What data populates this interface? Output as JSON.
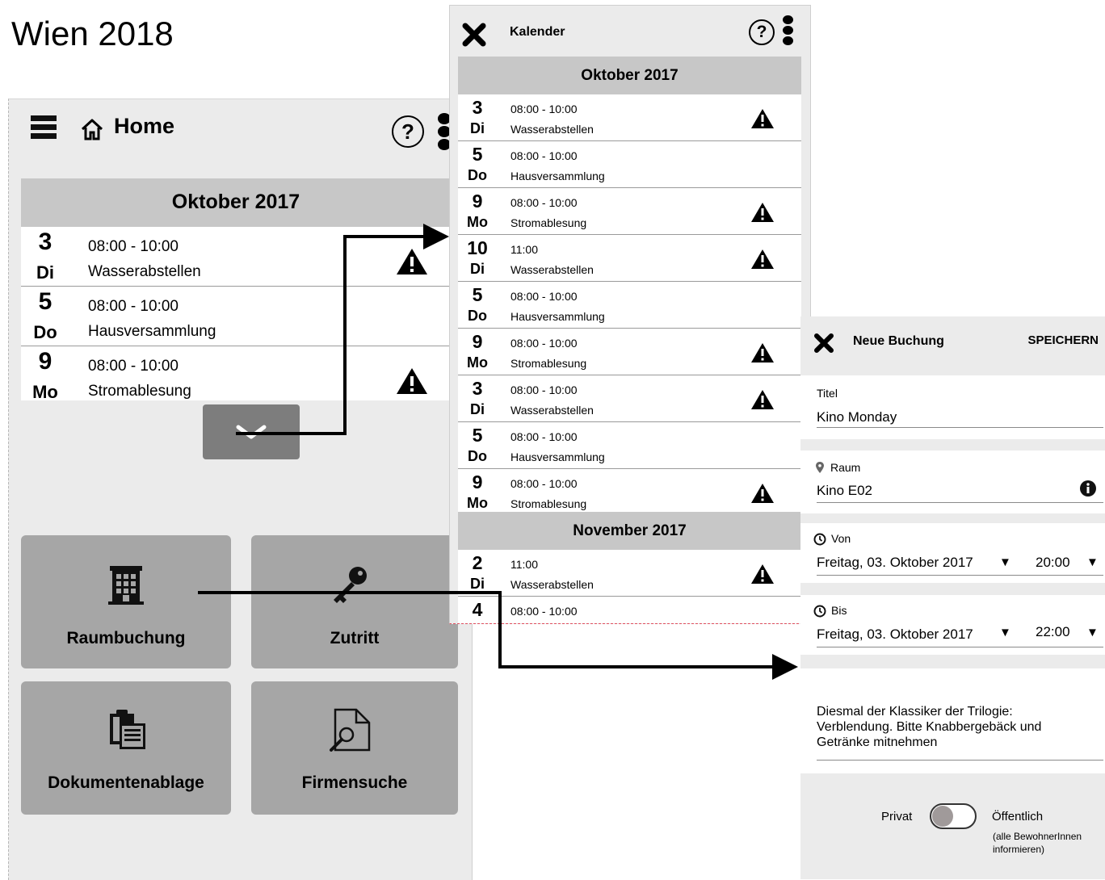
{
  "slide_title": "Wien 2018",
  "home": {
    "title": "Home",
    "help_label": "?",
    "month": "Oktober 2017",
    "events": [
      {
        "day": "3",
        "dow": "Di",
        "time": "08:00 - 10:00",
        "name": "Wasserabstellen",
        "warning": true
      },
      {
        "day": "5",
        "dow": "Do",
        "time": "08:00 - 10:00",
        "name": "Hausversammlung",
        "warning": false
      },
      {
        "day": "9",
        "dow": "Mo",
        "time": "08:00 - 10:00",
        "name": "Stromablesung",
        "warning": true
      }
    ],
    "tiles": [
      "Raumbuchung",
      "Zutritt",
      "Dokumentenablage",
      "Firmensuche"
    ]
  },
  "calendar": {
    "title": "Kalender",
    "help_label": "?",
    "months": [
      {
        "name": "Oktober 2017",
        "events": [
          {
            "day": "3",
            "dow": "Di",
            "time": "08:00 - 10:00",
            "name": "Wasserabstellen",
            "warning": true
          },
          {
            "day": "5",
            "dow": "Do",
            "time": "08:00 - 10:00",
            "name": "Hausversammlung",
            "warning": false
          },
          {
            "day": "9",
            "dow": "Mo",
            "time": "08:00 - 10:00",
            "name": "Stromablesung",
            "warning": true
          },
          {
            "day": "10",
            "dow": "Di",
            "time": "11:00",
            "name": "Wasserabstellen",
            "warning": true
          },
          {
            "day": "5",
            "dow": "Do",
            "time": "08:00 - 10:00",
            "name": "Hausversammlung",
            "warning": false
          },
          {
            "day": "9",
            "dow": "Mo",
            "time": "08:00 - 10:00",
            "name": "Stromablesung",
            "warning": true
          },
          {
            "day": "3",
            "dow": "Di",
            "time": "08:00 - 10:00",
            "name": "Wasserabstellen",
            "warning": true
          },
          {
            "day": "5",
            "dow": "Do",
            "time": "08:00 - 10:00",
            "name": "Hausversammlung",
            "warning": false
          },
          {
            "day": "9",
            "dow": "Mo",
            "time": "08:00 - 10:00",
            "name": "Stromablesung",
            "warning": true
          }
        ]
      },
      {
        "name": "November 2017",
        "events": [
          {
            "day": "2",
            "dow": "Di",
            "time": "11:00",
            "name": "Wasserabstellen",
            "warning": true
          },
          {
            "day": "4",
            "dow": "",
            "time": "08:00 - 10:00",
            "name": "",
            "warning": false
          }
        ]
      }
    ]
  },
  "booking": {
    "title": "Neue Buchung",
    "save_label": "SPEICHERN",
    "title_label": "Titel",
    "title_value": "Kino Monday",
    "room_label": "Raum",
    "room_value": "Kino E02",
    "from_label": "Von",
    "from_date": "Freitag, 03. Oktober 2017",
    "from_time": "20:00",
    "to_label": "Bis",
    "to_date": "Freitag, 03. Oktober 2017",
    "to_time": "22:00",
    "description": "Diesmal der Klassiker der Trilogie: Verblendung. Bitte Knabbergebäck und Getränke mitnehmen",
    "private_label": "Privat",
    "public_label": "Öffentlich",
    "public_note": "(alle BewohnerInnen informieren)"
  }
}
